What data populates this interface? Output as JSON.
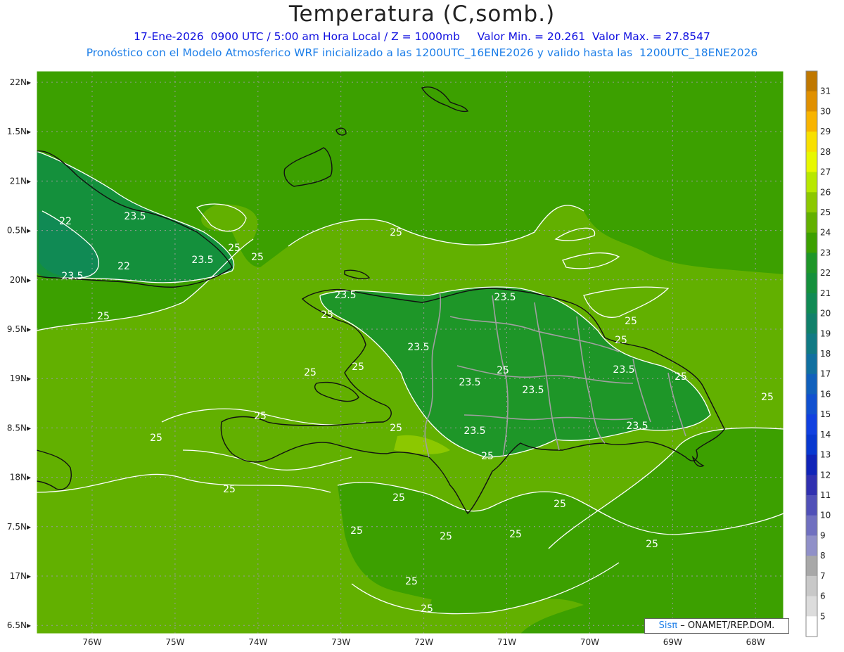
{
  "title": "Temperatura (C,somb.)",
  "subtitle_line1": "17-Ene-2026  0900 UTC / 5:00 am Hora Local / Z = 1000mb     Valor Min. = 20.261  Valor Max. = 27.8547",
  "subtitle_line2": "Pronóstico con el Modelo Atmosferico WRF inicializado a las 1200UTC_16ENE2026 y valido hasta las  1200UTC_18ENE2026",
  "credit": {
    "logo": "Sisπ",
    "text": "– ONAMET/REP.DOM."
  },
  "lat_labels": [
    "22N",
    "1.5N",
    "21N",
    "0.5N",
    "20N",
    "9.5N",
    "19N",
    "8.5N",
    "18N",
    "7.5N",
    "17N",
    "6.5N"
  ],
  "lon_labels": [
    "76W",
    "75W",
    "74W",
    "73W",
    "72W",
    "71W",
    "70W",
    "69W",
    "68W"
  ],
  "colorbar": {
    "labels": [
      "31",
      "30",
      "29",
      "28",
      "27",
      "26",
      "25",
      "24",
      "23",
      "22",
      "21",
      "20",
      "19",
      "18",
      "17",
      "16",
      "15",
      "14",
      "13",
      "12",
      "11",
      "10",
      "9",
      "8",
      "7",
      "6",
      "5"
    ],
    "colors": [
      "#c07800",
      "#e09000",
      "#f8b400",
      "#f8e000",
      "#e8f800",
      "#b8e800",
      "#8cc800",
      "#62b000",
      "#3ca000",
      "#1e9628",
      "#14903c",
      "#108a54",
      "#10806a",
      "#107a84",
      "#1070a0",
      "#1060bc",
      "#1050d0",
      "#1040e0",
      "#0838d0",
      "#1024b8",
      "#3030b0",
      "#5050b8",
      "#7070c0",
      "#9090c8",
      "#a8a8a8",
      "#c8c8c8",
      "#dcdcdc",
      "#ffffff"
    ]
  },
  "contour_labels": [
    {
      "text": "22"
    },
    {
      "text": "23.5"
    },
    {
      "text": "25"
    },
    {
      "text": "22"
    },
    {
      "text": "23.5"
    },
    {
      "text": "23.5"
    },
    {
      "text": "25"
    },
    {
      "text": "25"
    },
    {
      "text": "25"
    },
    {
      "text": "23.5"
    },
    {
      "text": "23.5"
    },
    {
      "text": "25"
    },
    {
      "text": "25"
    },
    {
      "text": "25"
    },
    {
      "text": "25"
    },
    {
      "text": "23.5"
    },
    {
      "text": "25"
    },
    {
      "text": "23.5"
    },
    {
      "text": "23.5"
    },
    {
      "text": "25"
    },
    {
      "text": "23.5"
    },
    {
      "text": "25"
    },
    {
      "text": "25"
    },
    {
      "text": "23.5"
    },
    {
      "text": "25"
    },
    {
      "text": "25"
    },
    {
      "text": "23.5"
    },
    {
      "text": "25"
    },
    {
      "text": "25"
    },
    {
      "text": "25"
    },
    {
      "text": "25"
    },
    {
      "text": "25"
    },
    {
      "text": "25"
    },
    {
      "text": "25"
    },
    {
      "text": "25"
    },
    {
      "text": "25"
    },
    {
      "text": "25"
    }
  ],
  "map_colors": {
    "base": "#62b000",
    "field24": "#3ca000",
    "field23": "#1e9628",
    "field22": "#14903c",
    "field21": "#108a54",
    "field26": "#8cc800",
    "coast": "#111111",
    "border": "#a0a0a0",
    "contour": "#ffffff",
    "grid": "#9a9a9a"
  }
}
